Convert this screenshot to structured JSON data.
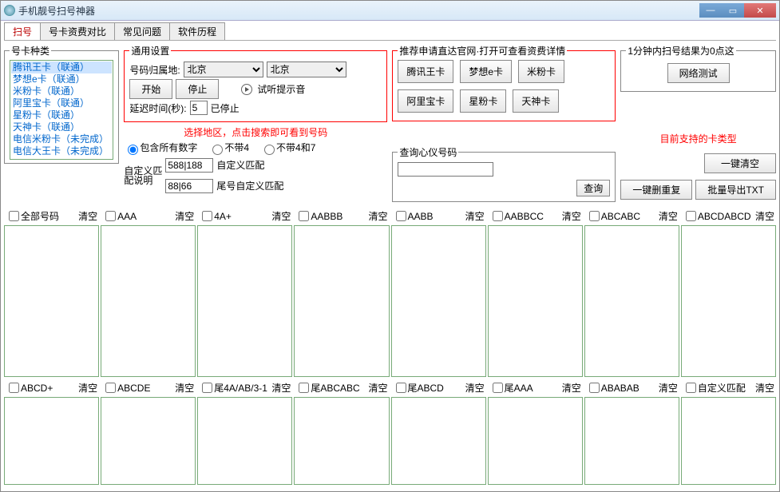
{
  "window": {
    "title": "手机靓号扫号神器"
  },
  "tabs": {
    "scan": "扫号",
    "compare": "号卡资费对比",
    "faq": "常见问题",
    "history": "软件历程"
  },
  "cardtypes": {
    "legend": "号卡种类",
    "items": [
      "腾讯王卡（联通）",
      "梦想e卡（联通）",
      "米粉卡（联通）",
      "阿里宝卡（联通）",
      "星粉卡（联通）",
      "天神卡（联通）",
      "电信米粉卡（未完成）",
      "电信大王卡（未完成）"
    ]
  },
  "general": {
    "legend": "通用设置",
    "loc_label": "号码归属地:",
    "loc1": "北京",
    "loc2": "北京",
    "start": "开始",
    "stop": "停止",
    "tone": "试听提示音",
    "delay_label": "延迟时间(秒):",
    "delay_val": "5",
    "status": "已停止",
    "hint": "选择地区，点击搜索即可看到号码",
    "radio_all": "包含所有数字",
    "radio_no4": "不带4",
    "radio_no47": "不带4和7",
    "custom_label": "自定义匹配说明",
    "in1": "588|188",
    "in2": "88|66",
    "match1": "自定义匹配",
    "match2": "尾号自定义匹配"
  },
  "recommend": {
    "legend": "推荐申请直达官网·打开可查看资费详情",
    "cards": [
      "腾讯王卡",
      "梦想e卡",
      "米粉卡",
      "阿里宝卡",
      "星粉卡",
      "天神卡"
    ],
    "note": "目前支持的卡类型"
  },
  "right": {
    "legend": "1分钟内扫号结果为0点这",
    "netbtn": "网络测试",
    "clear": "一键清空",
    "dedup": "一键删重复",
    "export": "批量导出TXT"
  },
  "query": {
    "legend": "查询心仪号码",
    "btn": "查询"
  },
  "panels": {
    "clear": "清空",
    "row1": [
      "全部号码",
      "AAA",
      "4A+",
      "AABBB",
      "AABB",
      "AABBCC",
      "ABCABC",
      "ABCDABCD"
    ],
    "row2": [
      "ABCD+",
      "ABCDE",
      "尾4A/AB/3-1",
      "尾ABCABC",
      "尾ABCD",
      "尾AAA",
      "ABABAB",
      "自定义匹配"
    ]
  }
}
